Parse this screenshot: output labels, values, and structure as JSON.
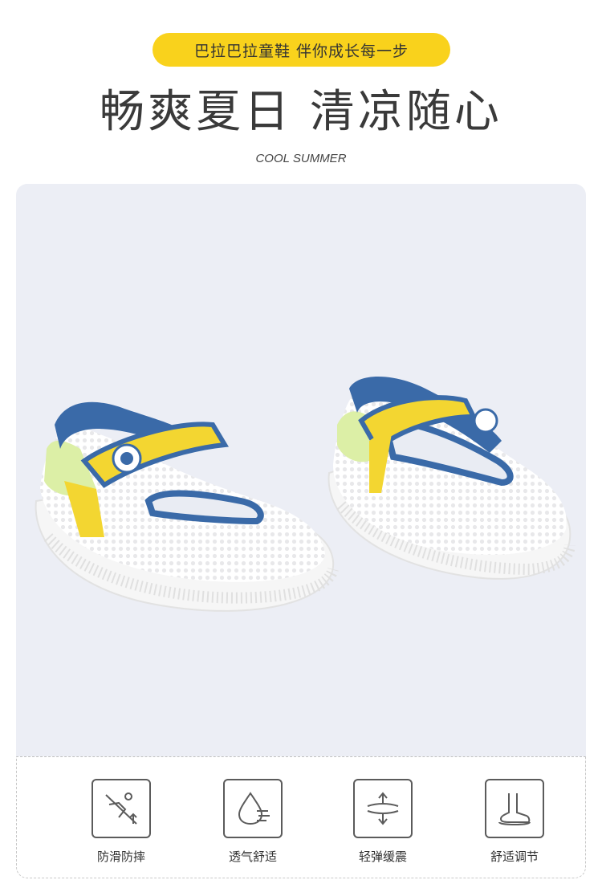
{
  "header": {
    "tagline": "巴拉巴拉童鞋 伴你成长每一步",
    "title": "畅爽夏日 清凉随心",
    "subtitle": "COOL SUMMER",
    "accent_color": "#f9d21c"
  },
  "product_image": {
    "subject": "pair of white mesh children's shoes with blue trim and yellow strap",
    "colors": {
      "background": "#eceef5",
      "trim": "#3a6aa8",
      "strap": "#f3d631",
      "upper": "#ffffff"
    }
  },
  "features": [
    {
      "icon": "anti-slip-icon",
      "label": "防滑防摔"
    },
    {
      "icon": "breathable-icon",
      "label": "透气舒适"
    },
    {
      "icon": "cushion-icon",
      "label": "轻弹缓震"
    },
    {
      "icon": "foot-fit-icon",
      "label": "舒适调节"
    }
  ]
}
